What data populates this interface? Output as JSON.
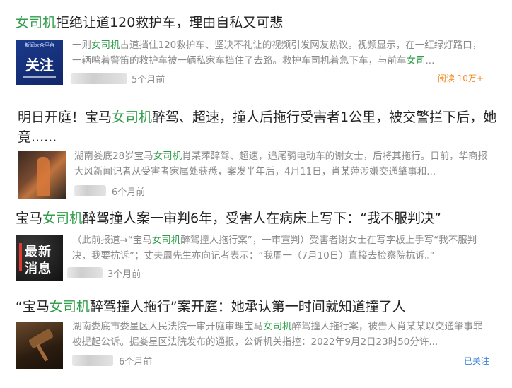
{
  "colors": {
    "highlight": "#2f9e4a",
    "read": "#f08a24",
    "follow": "#3a82d8",
    "muted": "#8a8a8a"
  },
  "articles": [
    {
      "title_pre": "",
      "title_hl": "女司机",
      "title_post": "拒绝让道120救护车，理由自私又可悲",
      "summary_pre": "一则",
      "summary_hl": "女司机",
      "summary_mid": "占道挡住120救护车、坚决不礼让的视频引发网友热议。视频显示，在一红绿灯路口，一辆鸣着警笛的救护车被一辆私家车挡住了去路。救护车司机着急下车，与前车",
      "summary_hl2": "女司",
      "summary_post": "...",
      "thumb_text": "关注",
      "thumb_small": "新闻大众平台",
      "time": "5个月前",
      "right_label": "阅读 10万+"
    },
    {
      "title_line1_pre": "明日开庭！宝马",
      "title_hl": "女司机",
      "title_line1_post": "醉驾、超速，撞人后拖行受害者1公里，被交警拦下后，她",
      "title_line2": "竟......",
      "summary_pre": "湖南娄底28岁宝马",
      "summary_hl": "女司机",
      "summary_post": "肖某萍醉驾、超速，追尾骑电动车的谢女士，后将其拖行。日前，华商报大风新闻记者从受害者家属处获悉，案发半年后，4月11日，肖某萍涉嫌交通肇事和...",
      "time": "6个月前"
    },
    {
      "title_pre": "宝马",
      "title_hl": "女司机",
      "title_post": "醉驾撞人案一审判6年，受害人在病床上写下：“我不服判决”",
      "summary_pre": "（此前报道→“宝马",
      "summary_hl": "女司机",
      "summary_post": "醉驾撞人拖行案”，一审宣判）受害者谢女士在写字板上手写“我不服判决，我要抗诉”；丈夫周先生亦向记者表示：“我周一（7月10日）直接去检察院抗诉。”",
      "thumb_text_1": "最新",
      "thumb_text_2": "消息",
      "time": "3个月前"
    },
    {
      "title_pre": "“宝马",
      "title_hl": "女司机",
      "title_post": "醉驾撞人拖行”案开庭：她承认第一时间就知道撞了人",
      "summary_pre": "湖南娄底市娄星区人民法院一审开庭审理宝马",
      "summary_hl": "女司机",
      "summary_post": "醉驾撞人拖行案，被告人肖某某以交通肇事罪被提起公诉。据娄星区法院发布的通报，公诉机关指控：2022年9月2日23时50分许...",
      "time": "6个月前",
      "right_label": "已关注"
    }
  ]
}
